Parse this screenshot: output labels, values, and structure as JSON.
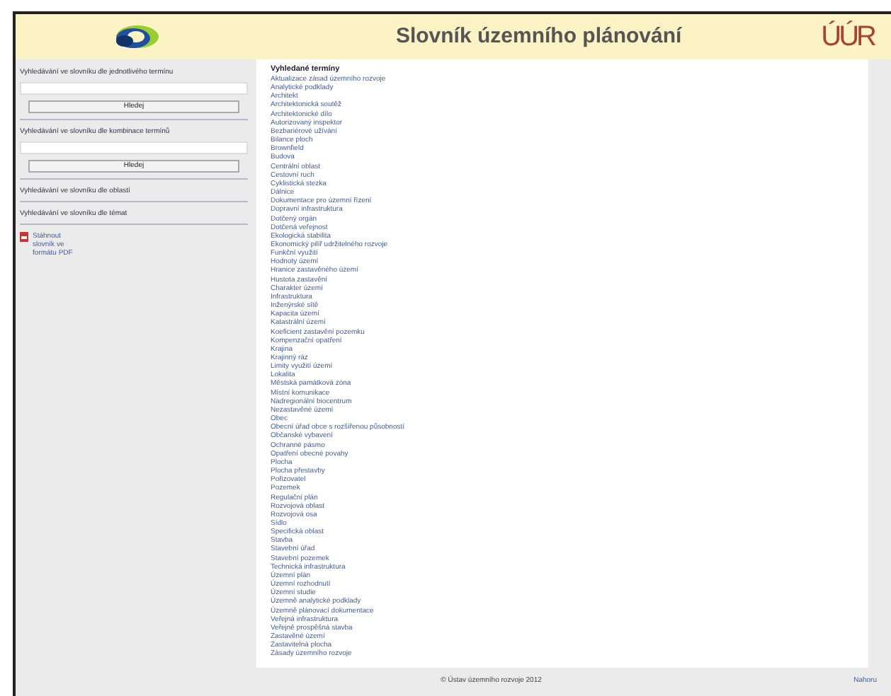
{
  "header": {
    "title": "Slovník územního plánování",
    "brand": "ÚÚR"
  },
  "sidebar": [
    {
      "kind": "search",
      "label": "Vyhledávání ve slovníku dle jednotlivého termínu",
      "button": "Hledej"
    },
    {
      "kind": "search",
      "label": "Vyhledávání ve slovníku dle kombinace termínů",
      "button": "Hledej"
    },
    {
      "kind": "link",
      "label": "Vyhledávání ve slovníku dle oblastí"
    },
    {
      "kind": "link",
      "label": "Vyhledávání ve slovníku dle témat"
    },
    {
      "kind": "download",
      "label": "Stáhnout slovník ve formátu PDF"
    }
  ],
  "content": {
    "heading": "Vyhledané termíny",
    "terms": [
      "Aktualizace zásad územního rozvoje",
      "Analytické podklady",
      "Architekt",
      "Architektonická soutěž",
      "Architektonické dílo",
      "Autorizovaný inspektor",
      "Bezbariérové užívání",
      "Bilance ploch",
      "Brownfield",
      "Budova",
      "Centrální oblast",
      "Cestovní ruch",
      "Cyklistická stezka",
      "Dálnice",
      "Dokumentace pro územní řízení",
      "Dopravní infrastruktura",
      "Dotčený orgán",
      "Dotčená veřejnost",
      "Ekologická stabilita",
      "Ekonomický pilíř udržitelného rozvoje",
      "Funkční využití",
      "Hodnoty území",
      "Hranice zastavěného území",
      "Hustota zastavění",
      "Charakter území",
      "Infrastruktura",
      "Inženýrské sítě",
      "Kapacita území",
      "Katastrální území",
      "Koeficient zastavění pozemku",
      "Kompenzační opatření",
      "Krajina",
      "Krajinný ráz",
      "Limity využití území",
      "Lokalita",
      "Městská památková zóna",
      "Místní komunikace",
      "Nadregionální biocentrum",
      "Nezastavěné území",
      "Obec",
      "Obecní úřad obce s rozšířenou působností",
      "Občanské vybavení",
      "Ochranné pásmo",
      "Opatření obecné povahy",
      "Plocha",
      "Plocha přestavby",
      "Pořizovatel",
      "Pozemek",
      "Regulační plán",
      "Rozvojová oblast",
      "Rozvojová osa",
      "Sídlo",
      "Specifická oblast",
      "Stavba",
      "Stavební úřad",
      "Stavební pozemek",
      "Technická infrastruktura",
      "Územní plán",
      "Územní rozhodnutí",
      "Územní studie",
      "Územně analytické podklady",
      "Územně plánovací dokumentace",
      "Veřejná infrastruktura",
      "Veřejně prospěšná stavba",
      "Zastavěné území",
      "Zastavitelná plocha",
      "Zásady územního rozvoje"
    ]
  },
  "footer": {
    "copyright": "© Ústav územního rozvoje 2012",
    "link": "Nahoru"
  }
}
